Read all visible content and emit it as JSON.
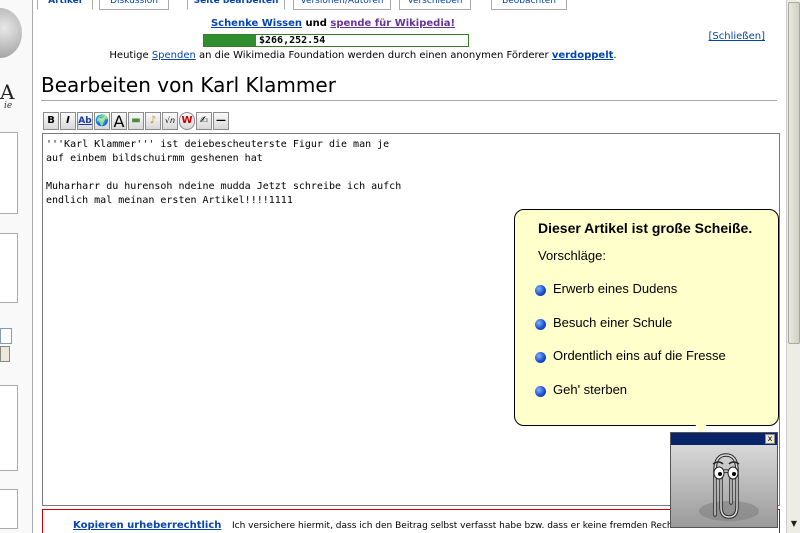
{
  "tabs": [
    {
      "label": "Artikel"
    },
    {
      "label": "Diskussion"
    },
    {
      "label": "Seite bearbeiten"
    },
    {
      "label": "Versionen/Autoren"
    },
    {
      "label": "Verschieben"
    },
    {
      "label": "Beobachten"
    }
  ],
  "logo": {
    "text": "A",
    "subtitle": "ie"
  },
  "notice": {
    "link1": "Schenke Wissen",
    "and": "und",
    "link2": "spende für Wikipedia!",
    "amount": "$266,252.54",
    "progress_fraction": 0.39,
    "line3_prefix": "Heutige",
    "line3_link": "Spenden",
    "line3_mid": "an die Wikimedia Foundation werden durch einen anonymen Förderer",
    "line3_link2": "verdoppelt",
    "line3_end": ".",
    "close": "[Schließen]"
  },
  "page_title": "Bearbeiten von Karl Klammer",
  "toolbar": {
    "buttons": [
      {
        "name": "bold-button",
        "label": "B"
      },
      {
        "name": "italic-button",
        "label": "I"
      },
      {
        "name": "internal-link-button",
        "label": "Ab"
      },
      {
        "name": "external-link-button",
        "label": "🌍"
      },
      {
        "name": "headline-button",
        "label": "A"
      },
      {
        "name": "image-button",
        "label": "▬"
      },
      {
        "name": "media-button",
        "label": "♪"
      },
      {
        "name": "math-button",
        "label": "√n"
      },
      {
        "name": "nowiki-button",
        "label": "W"
      },
      {
        "name": "signature-button",
        "label": "✍"
      },
      {
        "name": "hr-button",
        "label": "—"
      }
    ]
  },
  "editor": {
    "text": "'''Karl Klammer''' ist deiebescheuterste Figur die man je\nauf einbem bildschuirmm geshenen hat\n\nMuharharr du hurensoh ndeine mudda Jetzt schreibe ich aufch\nendlich mal meinan ersten Artikel!!!!1111"
  },
  "balloon": {
    "title": "Dieser Artikel ist große Scheiße.",
    "subtitle": "Vorschläge:",
    "items": [
      "Erwerb eines Dudens",
      "Besuch einer Schule",
      "Ordentlich eins auf die Fresse",
      "Geh' sterben"
    ]
  },
  "footer": {
    "link": "Kopieren urheberrechtlich",
    "text": "Ich versichere hiermit, dass ich den Beitrag selbst verfasst habe bzw. dass er keine fremden Rechte"
  },
  "scrollbar": {
    "arrow_down": "▼"
  },
  "clippy": {
    "close": "x"
  }
}
